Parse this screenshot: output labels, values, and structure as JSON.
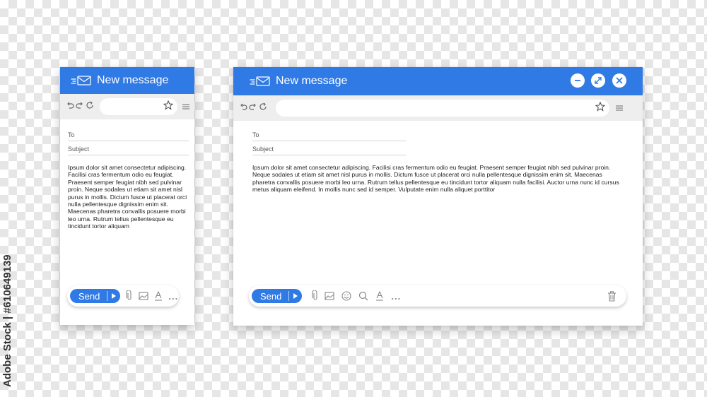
{
  "colors": {
    "accent": "#2f7ae5",
    "toolbar": "#eeeeee",
    "watermark": "#333333"
  },
  "watermark": {
    "text": "Adobe Stock | #610649139"
  },
  "small_window": {
    "title": "New message",
    "to_label": "To",
    "subject_label": "Subject",
    "body": "Ipsum dolor sit amet consectetur adipiscing. Facilisi cras fermentum odio eu feugiat. Praesent semper feugiat nibh sed pulvinar proin. Neque sodales ut etiam sit amet nisl purus in mollis. Dictum fusce ut placerat orci nulla pellentesque dignissim enim sit. Maecenas pharetra convallis posuere morbi leo urna. Rutrum tellus pellentesque eu tincidunt tortor aliquam",
    "send_label": "Send",
    "more_label": "..."
  },
  "large_window": {
    "title": "New message",
    "to_label": "To",
    "subject_label": "Subject",
    "body": "Ipsum dolor sit amet consectetur adipiscing. Facilisi cras fermentum odio eu feugiat. Praesent semper feugiat nibh sed pulvinar proin. Neque sodales ut etiam sit amet nisl purus in mollis. Dictum fusce ut placerat orci nulla pellentesque dignissim enim sit. Maecenas pharetra convallis posuere morbi leo urna. Rutrum tellus pellentesque eu tincidunt tortor aliquam nulla facilisi. Auctor urna nunc id cursus metus aliquam eleifend. In mollis nunc sed id semper. Vulputate enim nulla aliquet porttitor",
    "send_label": "Send",
    "more_label": "..."
  }
}
